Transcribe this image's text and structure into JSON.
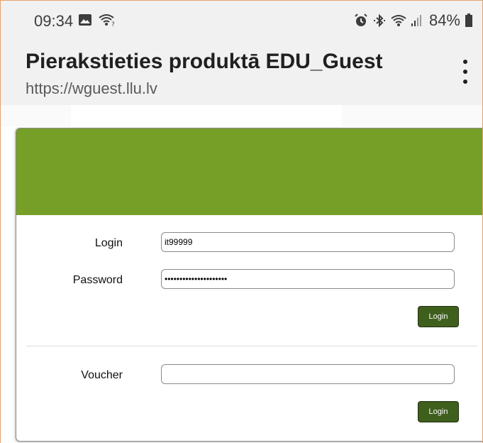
{
  "status_bar": {
    "time": "09:34",
    "battery": "84%",
    "icons": [
      "gallery-icon",
      "wifi-question-icon",
      "alarm-icon",
      "bluetooth-icon",
      "wifi-icon",
      "signal-icon",
      "battery-icon"
    ]
  },
  "header": {
    "title": "Pierakstieties produktā EDU_Guest",
    "url": "https://wguest.llu.lv",
    "menu_icon": "more-vert-icon"
  },
  "login_form": {
    "login_label": "Login",
    "login_value": "it99999",
    "password_label": "Password",
    "password_value": "•••••••••••••••••••••",
    "login_button": "Login"
  },
  "voucher_form": {
    "voucher_label": "Voucher",
    "voucher_value": "",
    "login_button": "Login"
  },
  "colors": {
    "banner": "#769f28",
    "button": "#3f5f1c"
  }
}
